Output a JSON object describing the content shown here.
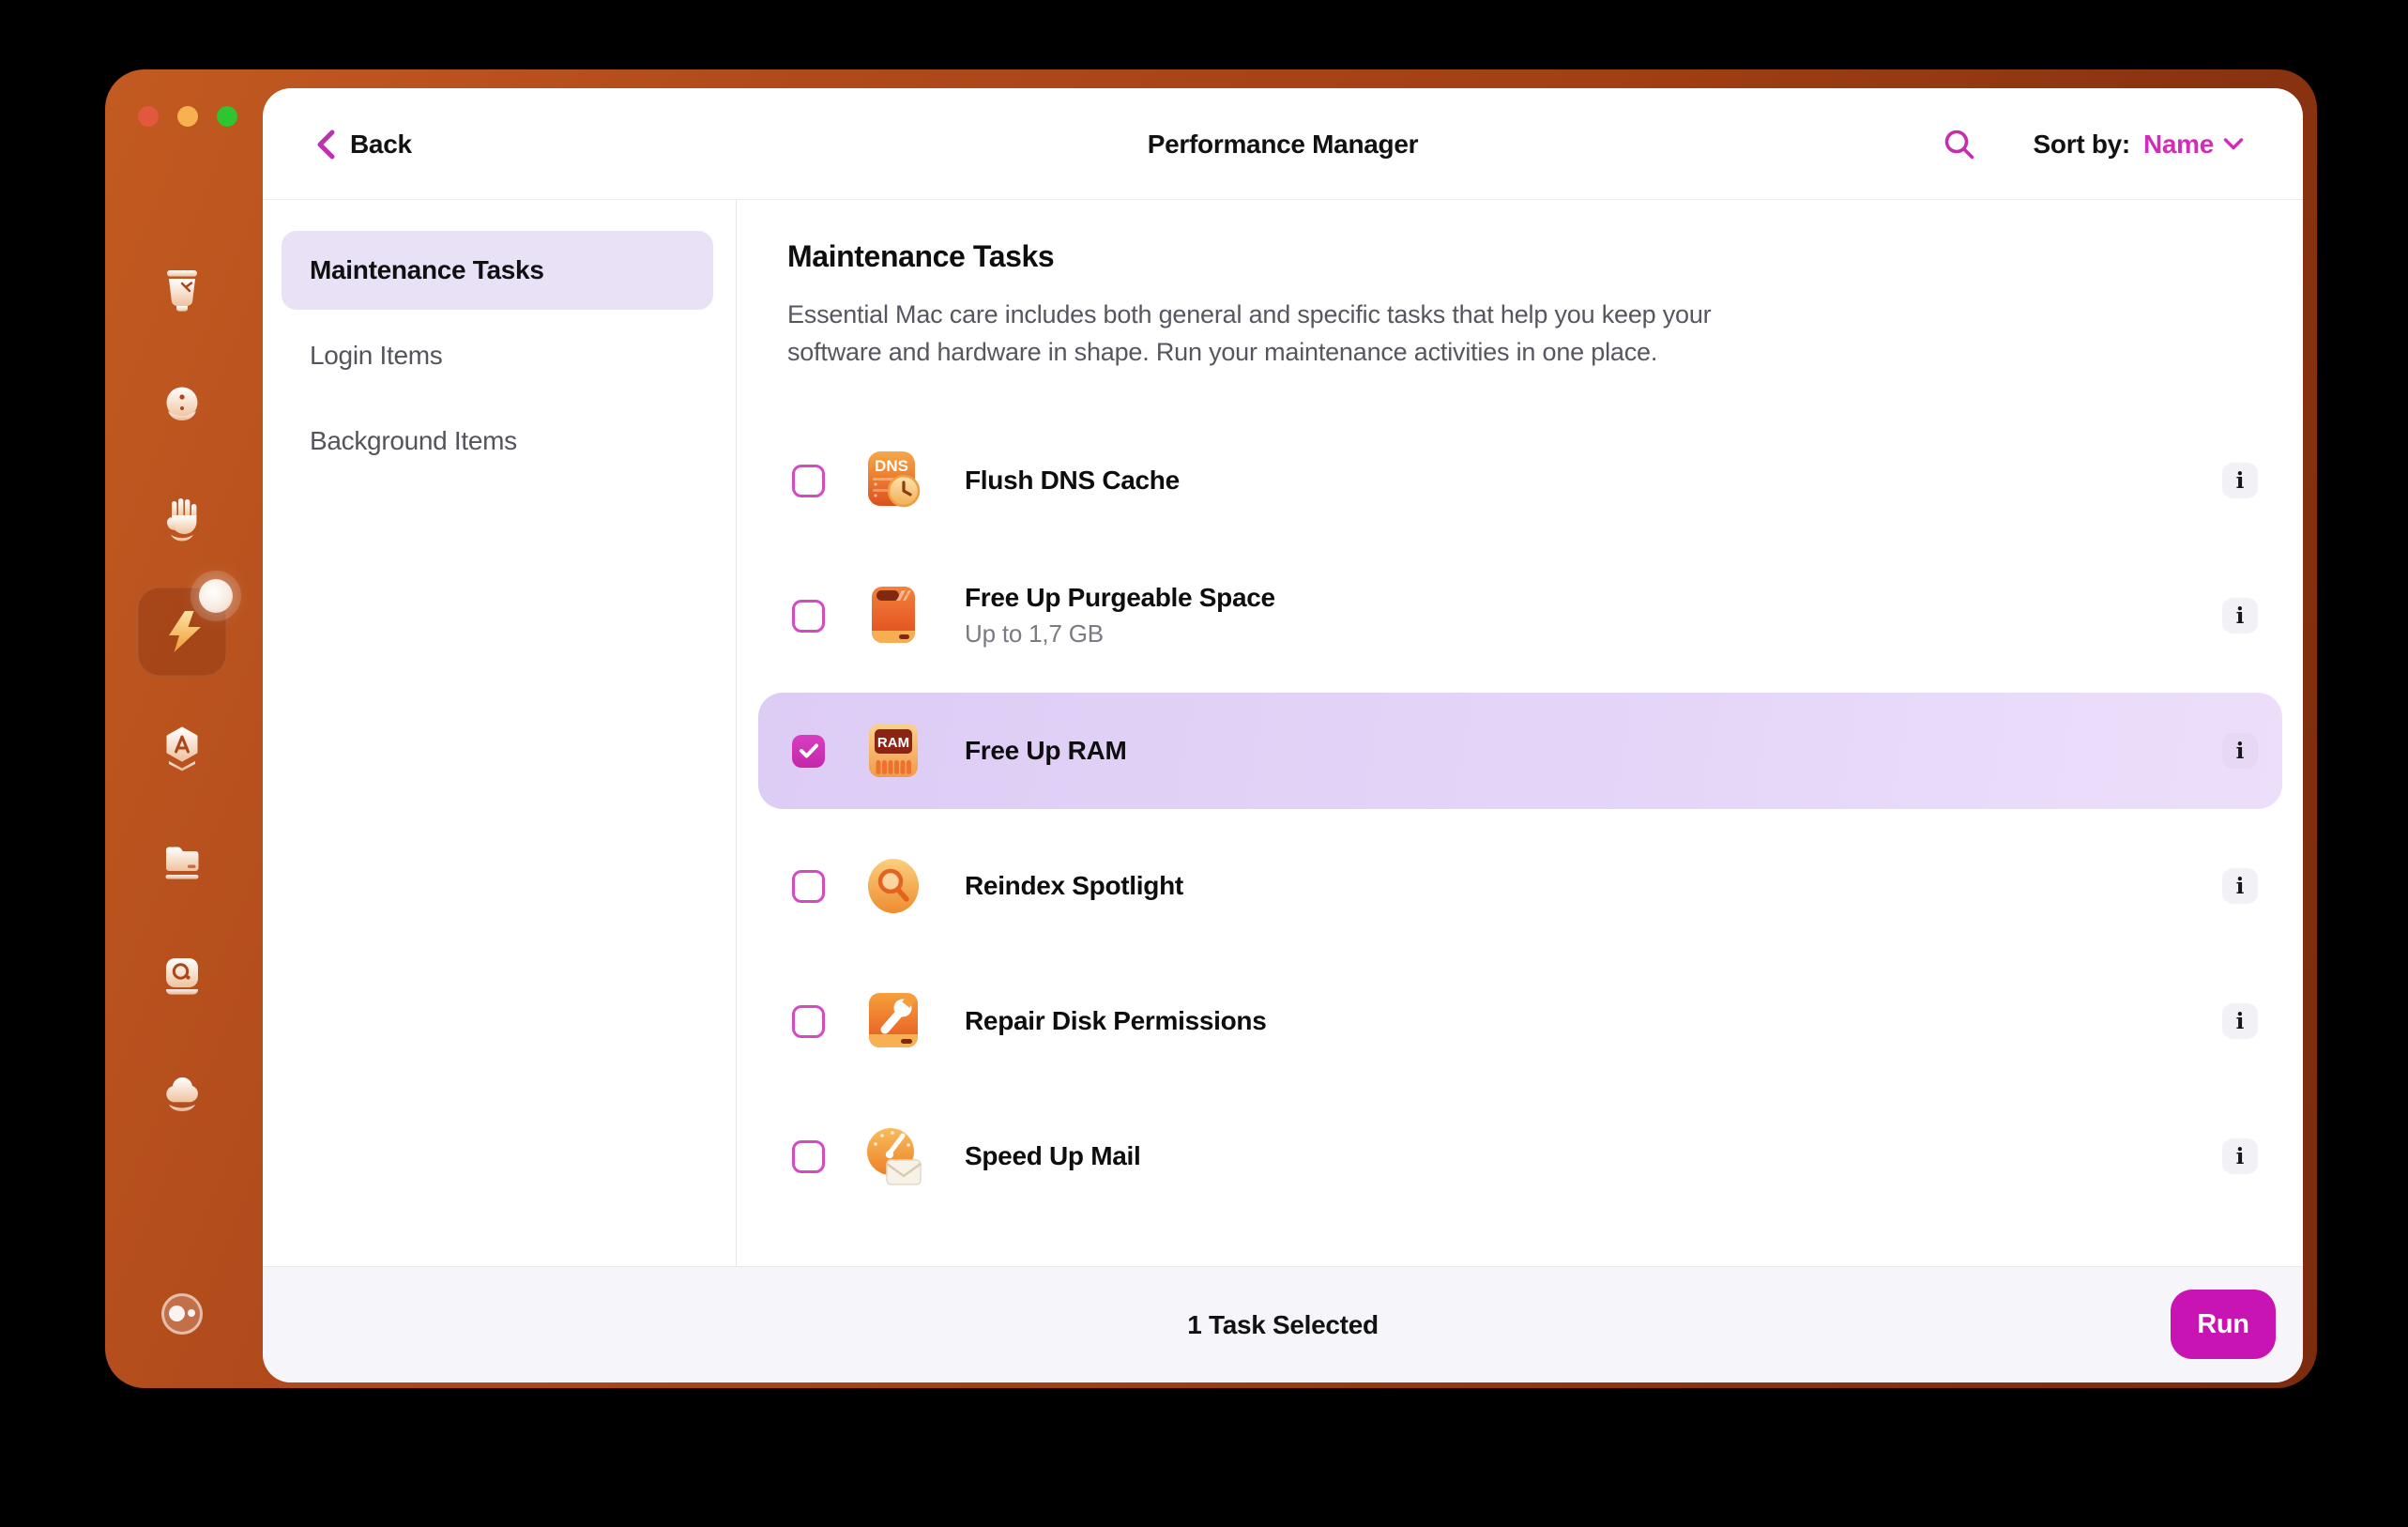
{
  "header": {
    "back_label": "Back",
    "title": "Performance Manager",
    "sort_by_label": "Sort by:",
    "sort_value": "Name"
  },
  "nav": {
    "items": [
      {
        "label": "Maintenance Tasks",
        "selected": true
      },
      {
        "label": "Login Items",
        "selected": false
      },
      {
        "label": "Background Items",
        "selected": false
      }
    ]
  },
  "main": {
    "heading": "Maintenance Tasks",
    "description": "Essential Mac care includes both general and specific tasks that help you keep your software and hardware in shape. Run your maintenance activities in one place.",
    "tasks": [
      {
        "label": "Flush DNS Cache",
        "checked": false,
        "icon": "dns-cache-icon"
      },
      {
        "label": "Free Up Purgeable Space",
        "sublabel": "Up to 1,7 GB",
        "checked": false,
        "icon": "purgeable-space-drive-icon"
      },
      {
        "label": "Free Up RAM",
        "checked": true,
        "selected": true,
        "icon": "ram-chip-icon"
      },
      {
        "label": "Reindex Spotlight",
        "checked": false,
        "icon": "spotlight-magnifier-icon"
      },
      {
        "label": "Repair Disk Permissions",
        "checked": false,
        "icon": "disk-wrench-icon"
      },
      {
        "label": "Speed Up Mail",
        "checked": false,
        "icon": "mail-speedometer-icon"
      }
    ]
  },
  "footer": {
    "status": "1 Task Selected",
    "run_label": "Run"
  },
  "icon_text": {
    "dns": "DNS",
    "ram": "RAM",
    "info": "i"
  },
  "colors": {
    "accent_magenta": "#c92eb2",
    "run_button": "#c714b2",
    "selected_row_bg": "#e3d4f7",
    "nav_selected_bg": "#e9e2f6",
    "frame_orange": "#a94518",
    "traffic_red": "#e2583c",
    "traffic_yellow": "#f7b14e",
    "traffic_green": "#2fc531"
  }
}
